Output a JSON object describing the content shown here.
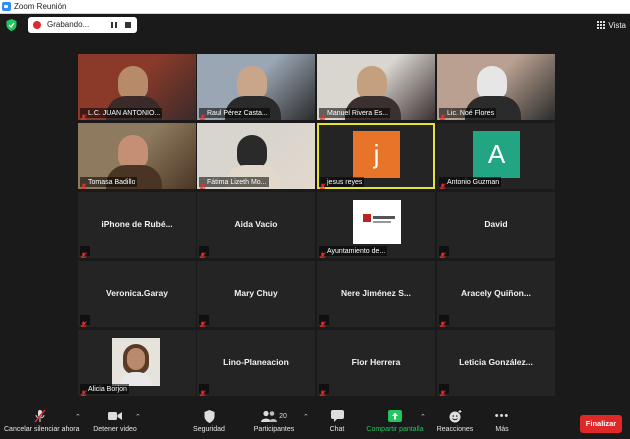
{
  "window": {
    "title": "Zoom Reunión"
  },
  "recording": {
    "label": "Grabando..."
  },
  "view": {
    "label": "Vista"
  },
  "participants_grid": [
    {
      "name": "L.C. JUAN ANTONIO...",
      "type": "video",
      "palette": [
        "#8b3a2a",
        "#b78a6a",
        "#3a2a2a"
      ]
    },
    {
      "name": "Raul Pérez Casta...",
      "type": "video",
      "palette": [
        "#9aa6b4",
        "#c9a58a",
        "#2a2a2a"
      ]
    },
    {
      "name": "Manuel Rivera Es...",
      "type": "video",
      "palette": [
        "#d9d5cf",
        "#c4a07e",
        "#3a3030"
      ]
    },
    {
      "name": "Lic. Noé Flores",
      "type": "video",
      "palette": [
        "#b9a090",
        "#e6e6e6",
        "#2b2b2b"
      ]
    },
    {
      "name": "Tomasa Badillo",
      "type": "video",
      "palette": [
        "#8e7a5e",
        "#c58f76",
        "#4a3525"
      ]
    },
    {
      "name": "Fátima Lizeth Mo...",
      "type": "video",
      "palette": [
        "#d8d4ce",
        "#2a2a2a",
        "#e2d9cc"
      ]
    },
    {
      "name": "jesus reyes",
      "type": "avatar",
      "letter": "j",
      "color": "#e8742a",
      "active": true
    },
    {
      "name": "Antonio Guzman",
      "type": "avatar",
      "letter": "A",
      "color": "#21a583"
    },
    {
      "name": "iPhone de Rubé...",
      "type": "text"
    },
    {
      "name": "Aida Vacio",
      "type": "text"
    },
    {
      "name": "Ayuntamiento de...",
      "type": "logo"
    },
    {
      "name": "David",
      "type": "text"
    },
    {
      "name": "Veronica.Garay",
      "type": "text"
    },
    {
      "name": "Mary Chuy",
      "type": "text"
    },
    {
      "name": "Nere Jiménez S...",
      "type": "text"
    },
    {
      "name": "Aracely Quiñon...",
      "type": "text"
    },
    {
      "name": "Alicia Borjon",
      "type": "photo",
      "palette": [
        "#e6e2dc",
        "#b98a6c",
        "#5a3a26"
      ]
    },
    {
      "name": "Lino-Planeacion",
      "type": "text"
    },
    {
      "name": "Flor Herrera",
      "type": "text"
    },
    {
      "name": "Leticia González...",
      "type": "text"
    }
  ],
  "toolbar": {
    "unmute_label": "Cancelar silenciar ahora",
    "video_label": "Detener video",
    "security_label": "Seguridad",
    "participants_label": "Participantes",
    "participants_count": "20",
    "chat_label": "Chat",
    "share_label": "Compartir pantalla",
    "reactions_label": "Reacciones",
    "more_label": "Más",
    "end_label": "Finalizar"
  },
  "colors": {
    "accent_green": "#22c55e",
    "end_red": "#e02828",
    "active_speaker": "#e7e42d"
  }
}
